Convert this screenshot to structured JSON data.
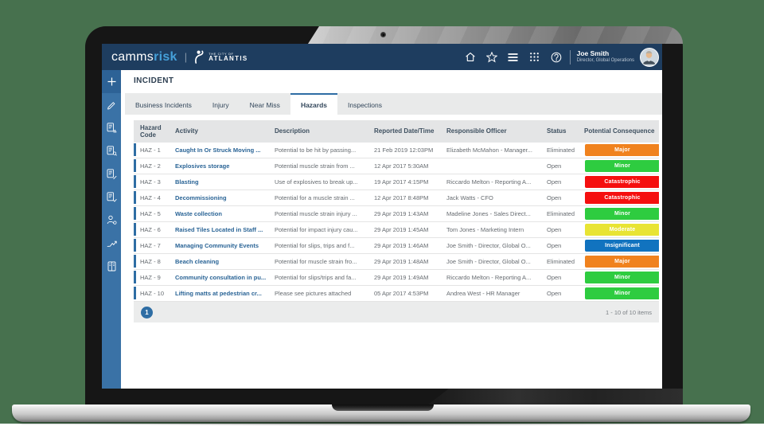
{
  "background_color": "#47714e",
  "header": {
    "logo": {
      "camms": "camms",
      "risk": "risk",
      "divider": "|"
    },
    "atlantis": {
      "line1": "THE CITY OF",
      "line2": "ATLANTIS"
    },
    "icons": [
      "home",
      "favorites-star",
      "menu",
      "app-grid",
      "help"
    ],
    "user": {
      "name": "Joe Smith",
      "role": "Director, Global Operations"
    }
  },
  "sidebar": {
    "items": [
      "add",
      "edit",
      "incident-document",
      "document-search",
      "document-edit",
      "document-check",
      "user-settings",
      "trend",
      "report-book"
    ]
  },
  "main": {
    "title": "INCIDENT",
    "tabs": [
      {
        "label": "Business Incidents",
        "active": false
      },
      {
        "label": "Injury",
        "active": false
      },
      {
        "label": "Near Miss",
        "active": false
      },
      {
        "label": "Hazards",
        "active": true
      },
      {
        "label": "Inspections",
        "active": false
      }
    ],
    "table": {
      "columns": [
        "Hazard Code",
        "Activity",
        "Description",
        "Reported Date/Time",
        "Responsible Officer",
        "Status",
        "Potential Consequence"
      ],
      "rows": [
        {
          "code": "HAZ - 1",
          "activity": "Caught In Or Struck Moving ...",
          "description": "Potential to be hit by passing...",
          "reported": "21 Feb 2019 12:03PM",
          "officer": "Elizabeth McMahon - Manager...",
          "status": "Eliminated",
          "consequence": "Major",
          "consequence_color": "#f0821e"
        },
        {
          "code": "HAZ - 2",
          "activity": "Explosives storage",
          "description": "Potential muscle strain from ...",
          "reported": "12 Apr 2017 5:30AM",
          "officer": "",
          "status": "Open",
          "consequence": "Minor",
          "consequence_color": "#2ecc40"
        },
        {
          "code": "HAZ - 3",
          "activity": "Blasting",
          "description": "Use of explosives to break up...",
          "reported": "19 Apr 2017 4:15PM",
          "officer": "Riccardo Melton - Reporting A...",
          "status": "Open",
          "consequence": "Catastrophic",
          "consequence_color": "#f50f0f"
        },
        {
          "code": "HAZ - 4",
          "activity": "Decommissioning",
          "description": "Potential for a muscle strain ...",
          "reported": "12 Apr 2017 8:48PM",
          "officer": "Jack Watts - CFO",
          "status": "Open",
          "consequence": "Catastrophic",
          "consequence_color": "#f50f0f"
        },
        {
          "code": "HAZ - 5",
          "activity": "Waste collection",
          "description": "Potential muscle strain injury ...",
          "reported": "29 Apr 2019 1:43AM",
          "officer": "Madeline Jones - Sales Direct...",
          "status": "Eliminated",
          "consequence": "Minor",
          "consequence_color": "#2ecc40"
        },
        {
          "code": "HAZ - 6",
          "activity": "Raised Tiles Located in Staff ...",
          "description": "Potential for impact injury cau...",
          "reported": "29 Apr 2019 1:45AM",
          "officer": "Tom Jones - Marketing Intern",
          "status": "Open",
          "consequence": "Moderate",
          "consequence_color": "#e8e434"
        },
        {
          "code": "HAZ - 7",
          "activity": "Managing Community Events",
          "description": "Potential for slips, trips and f...",
          "reported": "29 Apr 2019 1:46AM",
          "officer": "Joe Smith - Director, Global O...",
          "status": "Open",
          "consequence": "Insignificant",
          "consequence_color": "#1173bf"
        },
        {
          "code": "HAZ - 8",
          "activity": "Beach cleaning",
          "description": "Potential for muscle strain fro...",
          "reported": "29 Apr 2019 1:48AM",
          "officer": "Joe Smith - Director, Global O...",
          "status": "Eliminated",
          "consequence": "Major",
          "consequence_color": "#f0821e"
        },
        {
          "code": "HAZ - 9",
          "activity": "Community consultation in pu...",
          "description": "Potential for slips/trips and fa...",
          "reported": "29 Apr 2019 1:49AM",
          "officer": "Riccardo Melton - Reporting A...",
          "status": "Open",
          "consequence": "Minor",
          "consequence_color": "#2ecc40"
        },
        {
          "code": "HAZ - 10",
          "activity": "Lifting matts at pedestrian cr...",
          "description": "Please see pictures attached",
          "reported": "05 Apr 2017 4:53PM",
          "officer": "Andrea West - HR Manager",
          "status": "Open",
          "consequence": "Minor",
          "consequence_color": "#2ecc40"
        }
      ],
      "pagination": {
        "page": "1",
        "summary": "1 - 10 of 10 items"
      }
    }
  },
  "colors": {
    "accent": "#2e6da4",
    "header_navy": "#1e3d5f",
    "sidebar_blue": "#3a72a6",
    "major": "#f0821e",
    "minor": "#2ecc40",
    "catastrophic": "#f50f0f",
    "moderate": "#e8e434",
    "insignificant": "#1173bf"
  }
}
